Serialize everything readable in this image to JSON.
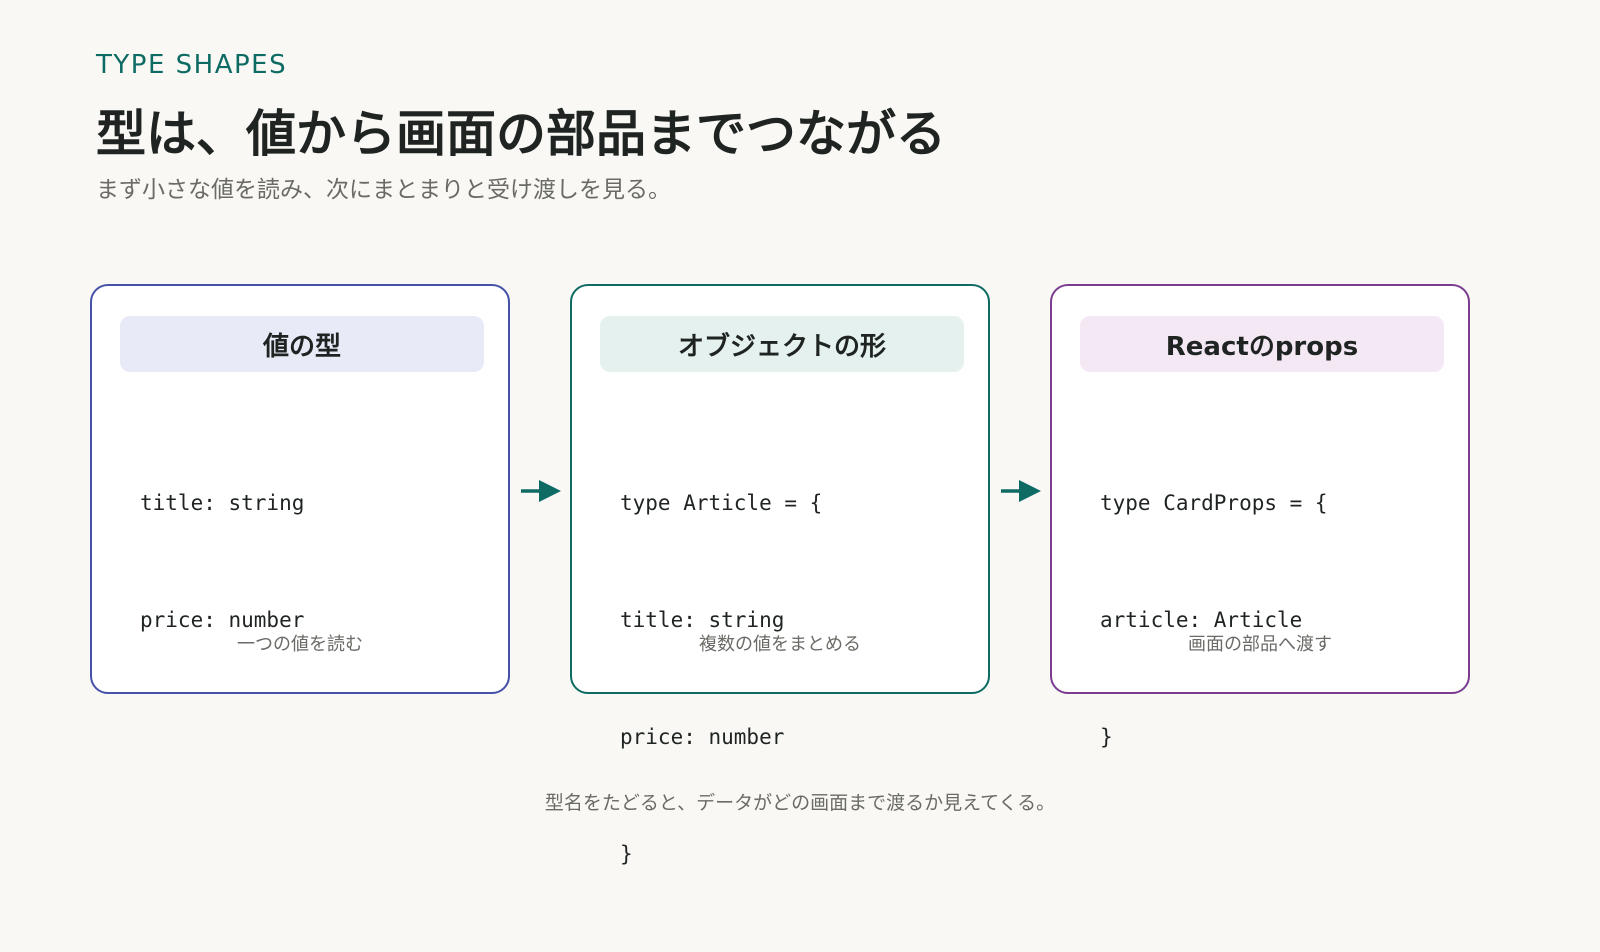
{
  "eyebrow": "TYPE SHAPES",
  "title": "型は、値から画面の部品までつながる",
  "subtitle": "まず小さな値を読み、次にまとまりと受け渡しを見る。",
  "colors": {
    "background": "#f9f8f5",
    "accent": "#0d6b63",
    "card1_border": "#4452a8",
    "card1_header_bg": "#e9eaf7",
    "card2_border": "#0d6b63",
    "card2_header_bg": "#e4f1ee",
    "card3_border": "#7a3d8f",
    "card3_header_bg": "#f3e8f4"
  },
  "cards": [
    {
      "title": "値の型",
      "code": [
        "title: string",
        "price: number"
      ],
      "caption": "一つの値を読む"
    },
    {
      "title": "オブジェクトの形",
      "code": [
        "type Article = {",
        "title: string",
        "price: number",
        "}"
      ],
      "caption": "複数の値をまとめる"
    },
    {
      "title": "Reactのprops",
      "code": [
        "type CardProps = {",
        "article: Article",
        "}"
      ],
      "caption": "画面の部品へ渡す"
    }
  ],
  "arrows": [
    "arrow-right-icon",
    "arrow-right-icon"
  ],
  "footer": "型名をたどると、データがどの画面まで渡るか見えてくる。"
}
